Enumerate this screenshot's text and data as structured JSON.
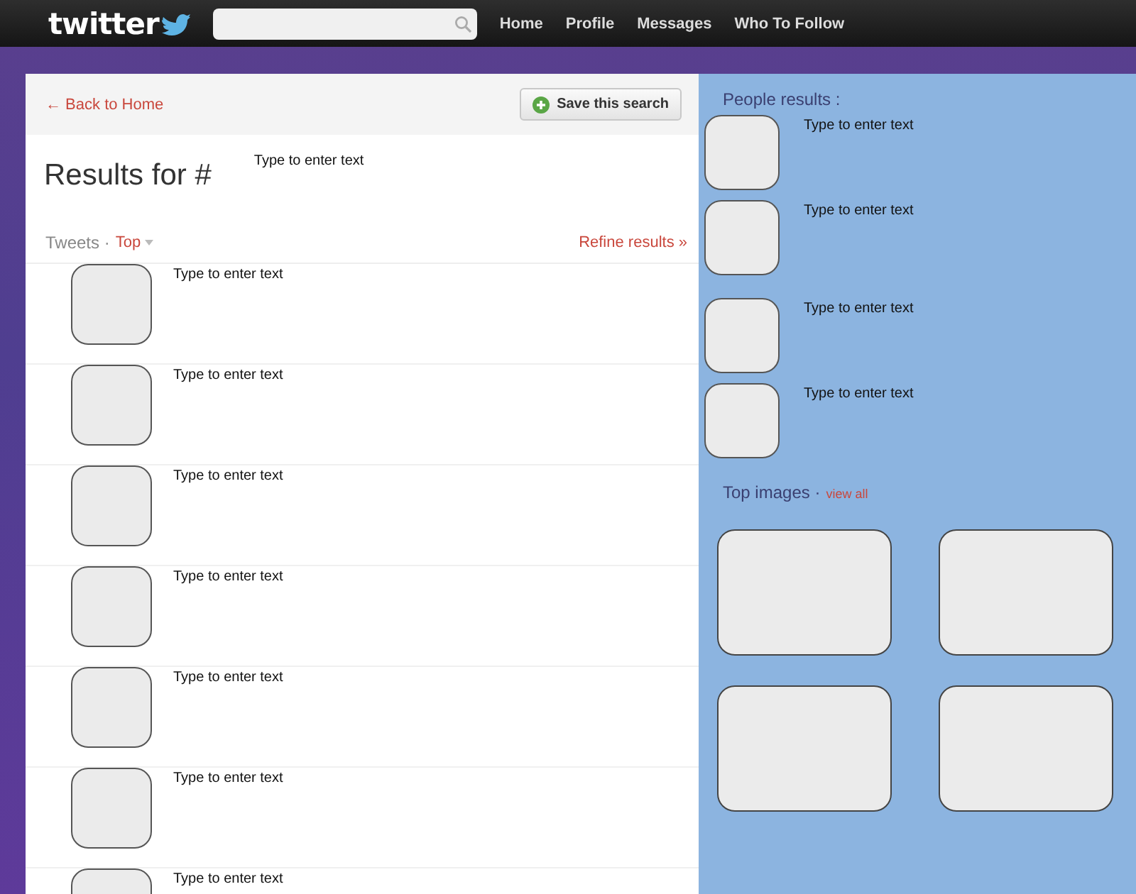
{
  "topbar": {
    "logo": "twitter",
    "nav": [
      "Home",
      "Profile",
      "Messages",
      "Who To Follow"
    ]
  },
  "results": {
    "back_link": "← Back to Home",
    "save_button": "Save this search",
    "title": "Results for #",
    "title_note": "Type to enter text",
    "filter_label": "Tweets ·",
    "filter_value": "Top",
    "refine_link": "Refine results »",
    "tweets": [
      {
        "text": "Type to enter text"
      },
      {
        "text": "Type to enter text"
      },
      {
        "text": "Type to enter text"
      },
      {
        "text": "Type to enter text"
      },
      {
        "text": "Type to enter text"
      },
      {
        "text": "Type to enter text"
      },
      {
        "text": "Type to enter text"
      }
    ]
  },
  "sidebar": {
    "people_title": "People results :",
    "people": [
      {
        "text": "Type to enter text"
      },
      {
        "text": "Type to enter text"
      },
      {
        "text": "Type to enter text"
      },
      {
        "text": "Type to enter text"
      }
    ],
    "images_title": "Top images ·",
    "images_link": "view all"
  }
}
